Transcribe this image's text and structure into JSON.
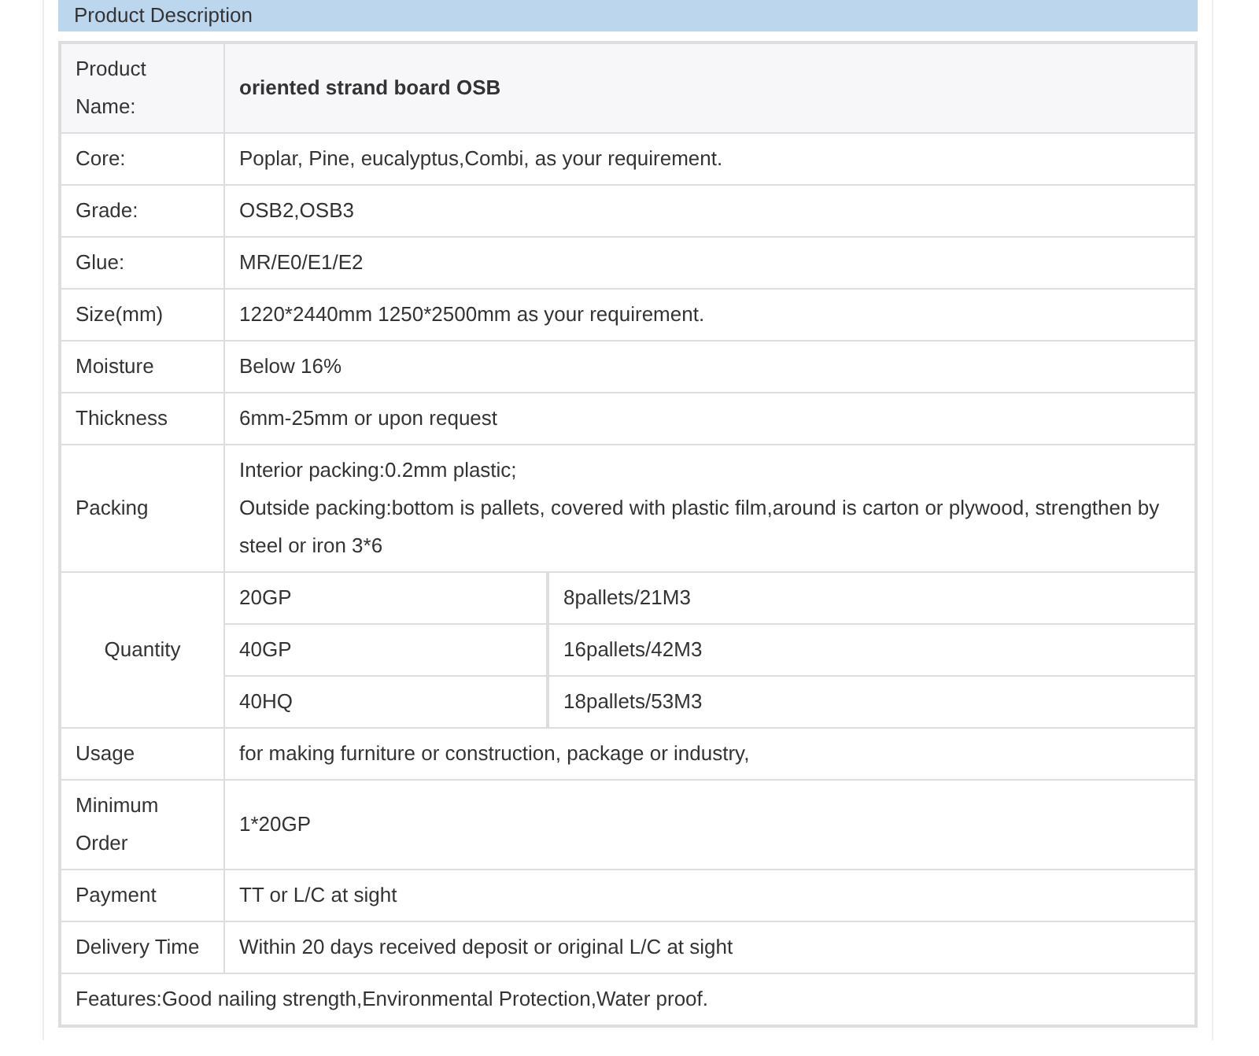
{
  "section_title": "Product Description",
  "rows": [
    {
      "kind": "pair",
      "label": "Product Name:",
      "value": "oriented strand board OSB",
      "highlighted": true
    },
    {
      "kind": "pair",
      "label": "Core:",
      "value": "Poplar, Pine, eucalyptus,Combi,  as your requirement.",
      "highlighted": false
    },
    {
      "kind": "pair",
      "label": "Grade:",
      "value": "OSB2,OSB3",
      "highlighted": false
    },
    {
      "kind": "pair",
      "label": "Glue:",
      "value": "MR/E0/E1/E2",
      "highlighted": false
    },
    {
      "kind": "pair",
      "label": "Size(mm)",
      "value": "1220*2440mm 1250*2500mm as your requirement.",
      "highlighted": false
    },
    {
      "kind": "pair",
      "label": "Moisture",
      "value": "Below 16%",
      "highlighted": false
    },
    {
      "kind": "pair",
      "label": "Thickness",
      "value": "6mm-25mm or upon request",
      "highlighted": false
    },
    {
      "kind": "lines",
      "label": "Packing",
      "lines": [
        "Interior packing:0.2mm plastic;",
        "Outside packing:bottom is pallets, covered with plastic film,around is carton or plywood, strengthen by steel or iron 3*6"
      ]
    },
    {
      "kind": "nested",
      "label": "Quantity",
      "subrows": [
        [
          "20GP",
          "8pallets/21M3"
        ],
        [
          "40GP",
          "16pallets/42M3"
        ],
        [
          "40HQ",
          "18pallets/53M3"
        ]
      ]
    },
    {
      "kind": "pair",
      "label": "Usage",
      "value": "for making furniture or construction, package or industry,",
      "highlighted": false
    },
    {
      "kind": "pair",
      "label": "Minimum Order",
      "value": "1*20GP",
      "highlighted": false
    },
    {
      "kind": "pair",
      "label": "Payment",
      "value": "TT or L/C at sight",
      "highlighted": false
    },
    {
      "kind": "pair",
      "label": "Delivery Time",
      "value": "Within 20 days received deposit or original L/C at sight",
      "highlighted": false
    },
    {
      "kind": "full",
      "value": "Features:Good nailing strength,Environmental Protection,Water proof."
    }
  ]
}
